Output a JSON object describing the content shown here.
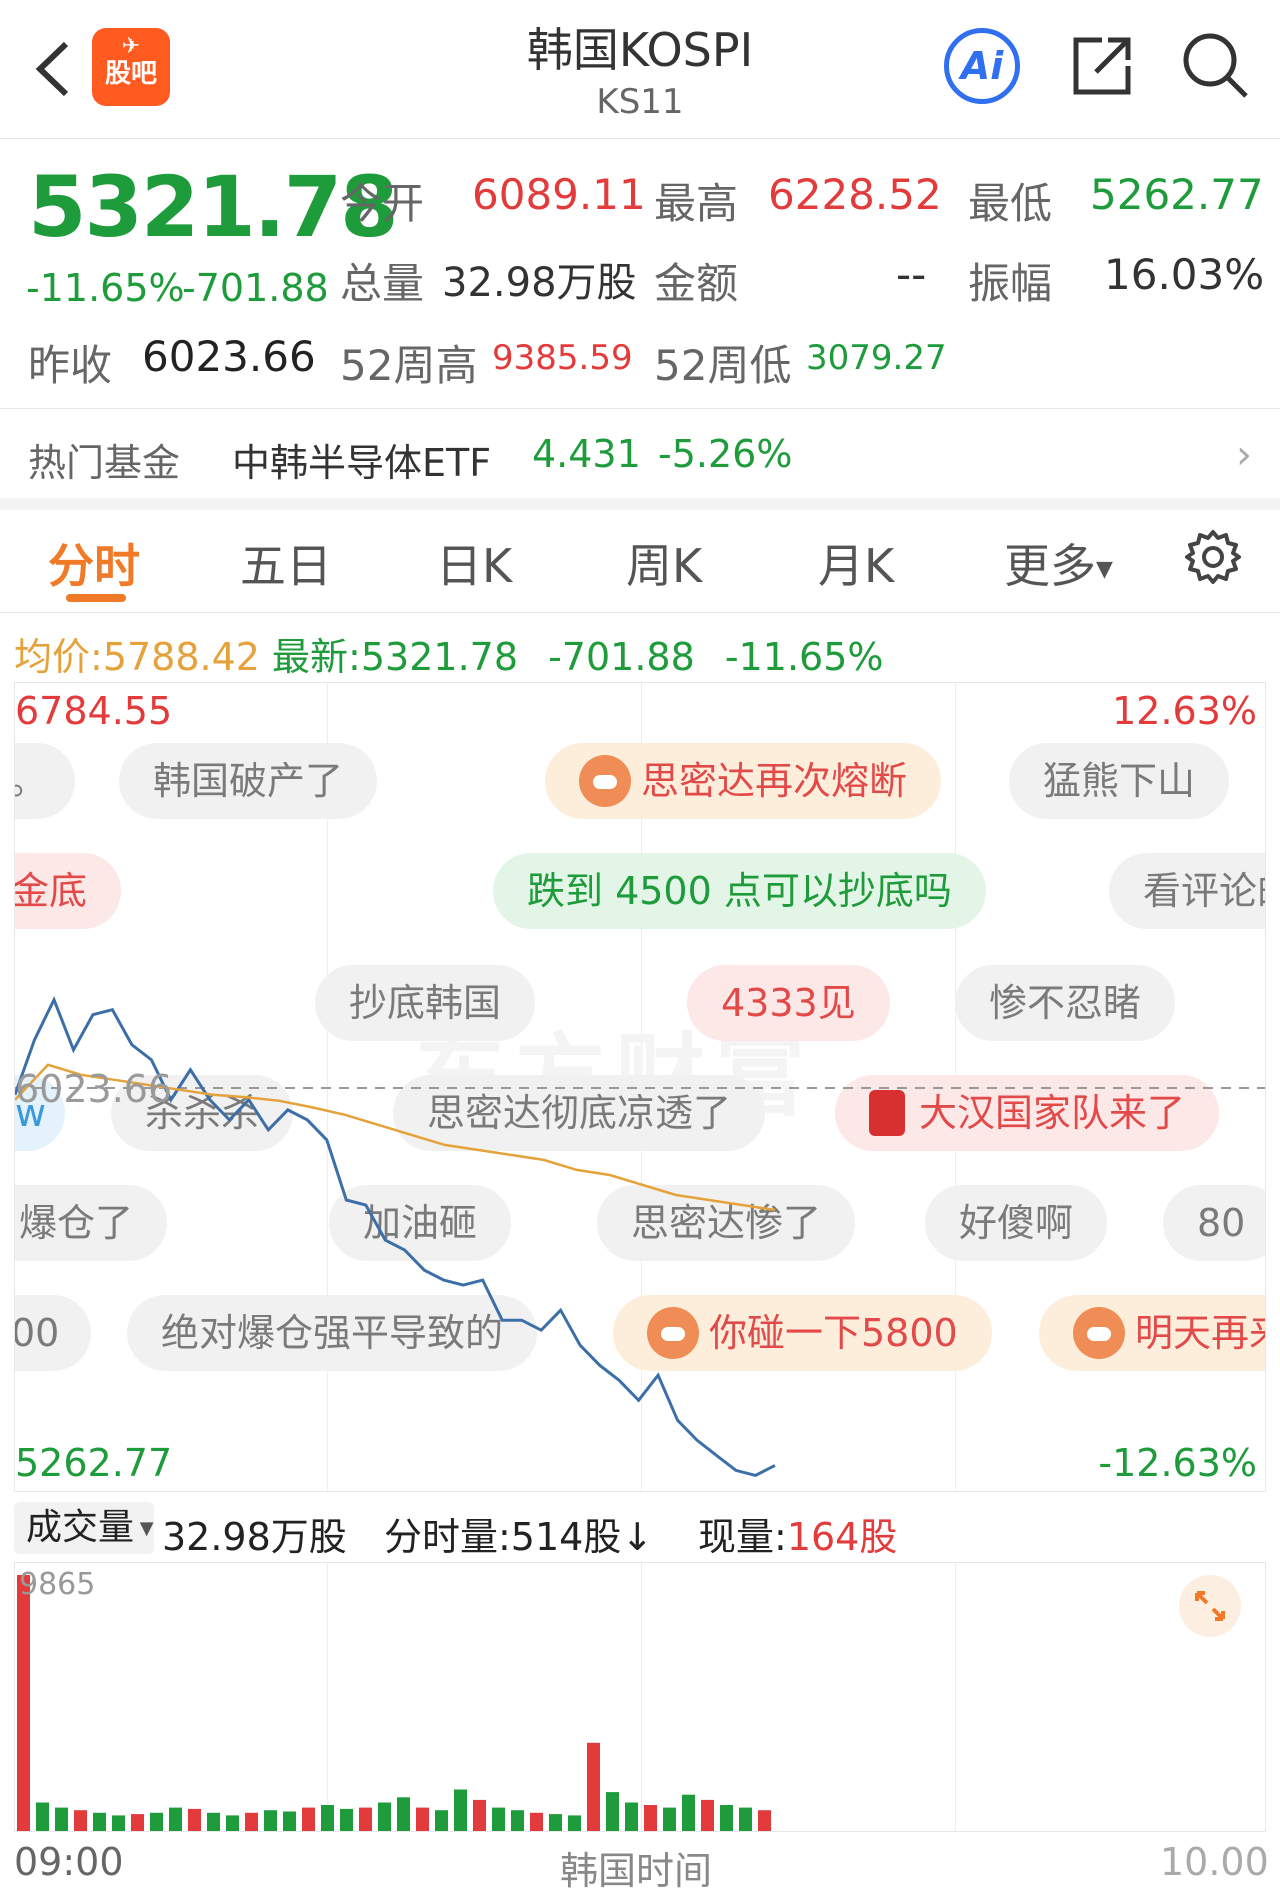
{
  "header": {
    "title": "韩国KOSPI",
    "code": "KS11",
    "logo_text": "股吧",
    "ai_label": "Ai"
  },
  "quote": {
    "price": "5321.78",
    "change_pct": "-11.65%",
    "change": "-701.88",
    "open_label": "今开",
    "open": "6089.11",
    "high_label": "最高",
    "high": "6228.52",
    "low_label": "最低",
    "low": "5262.77",
    "volume_label": "总量",
    "volume": "32.98万股",
    "amount_label": "金额",
    "amount": "--",
    "amplitude_label": "振幅",
    "amplitude": "16.03%",
    "prev_close_label": "昨收",
    "prev_close": "6023.66",
    "week52_high_label": "52周高",
    "week52_high": "9385.59",
    "week52_low_label": "52周低",
    "week52_low": "3079.27"
  },
  "hot_fund": {
    "label": "热门基金",
    "name": "中韩半导体ETF",
    "price": "4.431",
    "change": "-5.26%"
  },
  "tabs": [
    {
      "label": "分时",
      "active": true
    },
    {
      "label": "五日"
    },
    {
      "label": "日K"
    },
    {
      "label": "周K"
    },
    {
      "label": "月K"
    },
    {
      "label": "更多"
    }
  ],
  "info_bar": {
    "avg_label": "均价:",
    "avg": "5788.42",
    "latest_label": "最新:",
    "latest": "5321.78",
    "change": "-701.88",
    "change_pct": "-11.65%"
  },
  "chart_data": {
    "type": "line",
    "y_max_label": "6784.55",
    "y_min_label": "5262.77",
    "pct_max_label": "12.63%",
    "pct_min_label": "-12.63%",
    "prev_close_label": "6023.66",
    "series": [
      {
        "values": [
          6010,
          6120,
          6200,
          6100,
          6170,
          6180,
          6110,
          6080,
          6000,
          6060,
          6000,
          5960,
          6000,
          5940,
          5980,
          5960,
          5920,
          5800,
          5790,
          5720,
          5700,
          5660,
          5640,
          5630,
          5640,
          5560,
          5560,
          5540,
          5580,
          5510,
          5470,
          5440,
          5400,
          5450,
          5360,
          5320,
          5290,
          5260,
          5250,
          5270
        ]
      },
      {
        "values": [
          6000,
          6070,
          6050,
          6040,
          6030,
          6020,
          6010,
          6005,
          5998,
          5985,
          5970,
          5950,
          5930,
          5910,
          5900,
          5890,
          5880,
          5860,
          5850,
          5830,
          5810,
          5800,
          5790,
          5780
        ]
      }
    ],
    "volume_max_label": "9865",
    "volume_values": [
      9865,
      1100,
      900,
      800,
      700,
      600,
      650,
      700,
      900,
      850,
      700,
      600,
      700,
      800,
      750,
      900,
      1000,
      850,
      900,
      1100,
      1300,
      900,
      800,
      1600,
      1200,
      900,
      800,
      700,
      650,
      600,
      3400,
      1500,
      1100,
      1000,
      900,
      1400,
      1200,
      1000,
      900,
      800
    ],
    "x_start_label": "09:00",
    "x_center_label": "韩国时间"
  },
  "volume_bar": {
    "selector_label": "成交量",
    "total": "32.98万股",
    "tick_label": "分时量:514股↓",
    "now_label": "现量:",
    "now_value": "164股"
  },
  "comments": {
    "r1": [
      "。",
      "韩国破产了",
      "思密达再次熔断",
      "猛熊下山"
    ],
    "r2": [
      "金底",
      "跌到 4500 点可以抄底吗",
      "看评论的"
    ],
    "r3": [
      "抄底韩国",
      "4333见",
      "惨不忍睹"
    ],
    "r4": [
      "w",
      "杀杀杀",
      "思密达彻底凉透了",
      "大汉国家队来了"
    ],
    "r5": [
      "爆仓了",
      "加油砸",
      "思密达惨了",
      "好傻啊",
      "80"
    ],
    "r6": [
      "00",
      "绝对爆仓强平导致的",
      "你碰一下5800",
      "明天再来"
    ]
  },
  "watermark": "东方财富",
  "footer_right": "10.00"
}
